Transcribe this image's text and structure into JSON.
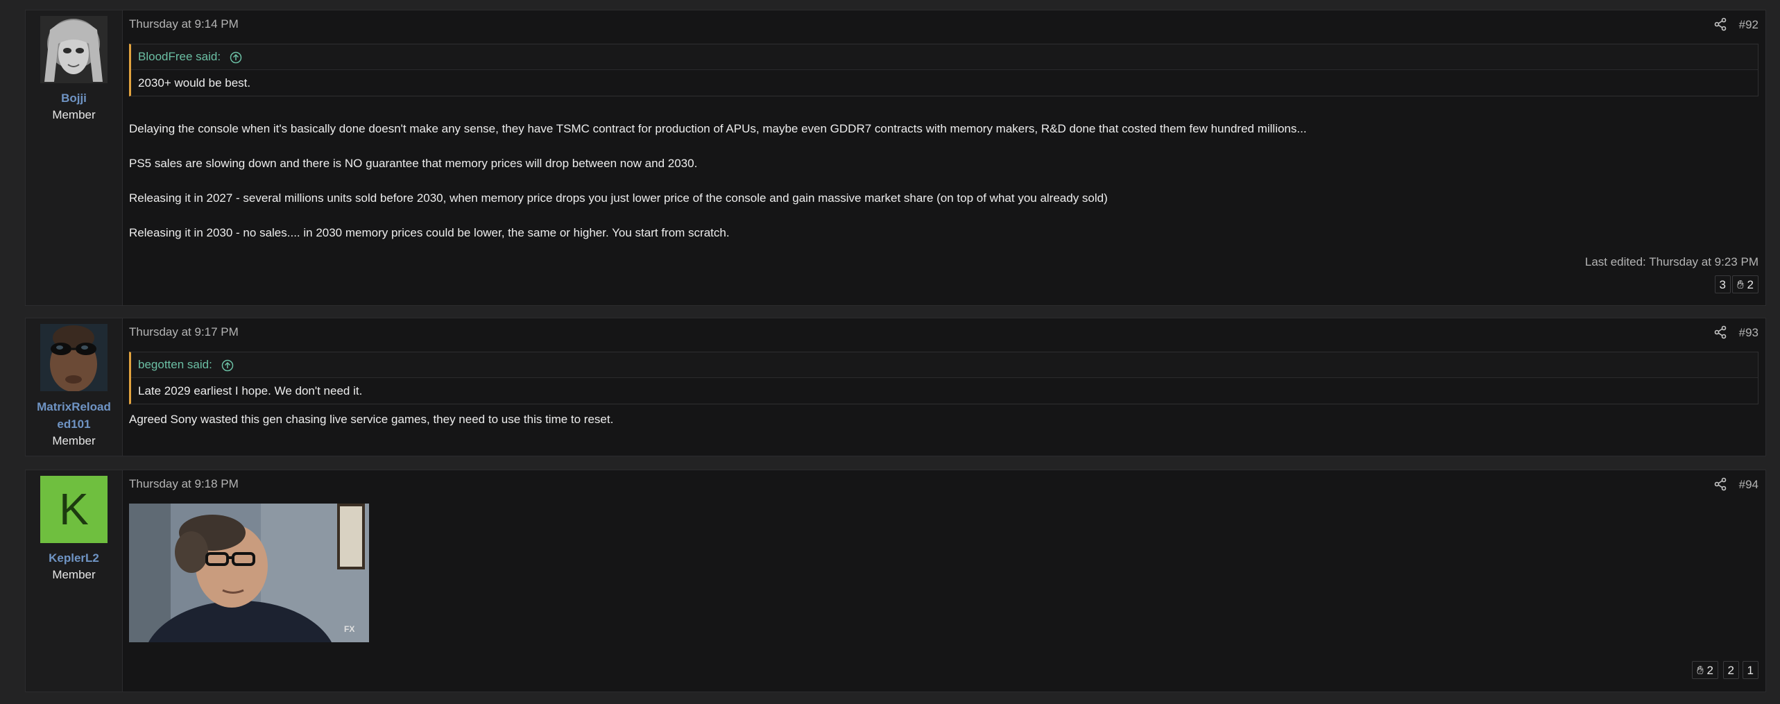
{
  "posts": [
    {
      "user": {
        "name": "Bojji",
        "role": "Member"
      },
      "date": "Thursday at 9:14 PM",
      "number": "#92",
      "quote": {
        "author": "BloodFree said:",
        "text": "2030+ would be best."
      },
      "paragraphs": [
        "Delaying the console when it's basically done doesn't make any sense, they have TSMC contract for production of APUs, maybe even GDDR7 contracts with memory makers, R&D done that costed them few hundred millions...",
        "PS5 sales are slowing down and there is NO guarantee that memory prices will drop between now and 2030.",
        "Releasing it in 2027 - several millions units sold before 2030, when memory price drops you just lower price of the console and gain massive market share (on top of what you already sold)",
        "Releasing it in 2030 - no sales.... in 2030 memory prices could be lower, the same or higher. You start from scratch."
      ],
      "edited": "Last edited: Thursday at 9:23 PM",
      "reactions": [
        {
          "label": "3"
        },
        {
          "icon": "hand-icon",
          "label": "2"
        }
      ]
    },
    {
      "user": {
        "name_line1": "MatrixReload",
        "name_line2": "ed101",
        "role": "Member"
      },
      "date": "Thursday at 9:17 PM",
      "number": "#93",
      "quote": {
        "author": "begotten said:",
        "text": "Late 2029 earliest I hope. We don't need it."
      },
      "paragraphs": [
        "Agreed Sony wasted this gen chasing live service games, they need to use this time to reset."
      ]
    },
    {
      "user": {
        "initial": "K",
        "name": "KeplerL2",
        "role": "Member",
        "avatar_color": "#6fbf3f"
      },
      "date": "Thursday at 9:18 PM",
      "number": "#94",
      "image": {
        "watermark": "FX"
      },
      "reactions": [
        {
          "icon": "hand-icon",
          "label": "2"
        },
        {
          "label": "2"
        },
        {
          "label": "1"
        }
      ]
    }
  ],
  "colors": {
    "accent_link": "#6bbfa4",
    "quote_bar": "#e2a33f",
    "username": "#6f94c4",
    "background": "#232324"
  }
}
